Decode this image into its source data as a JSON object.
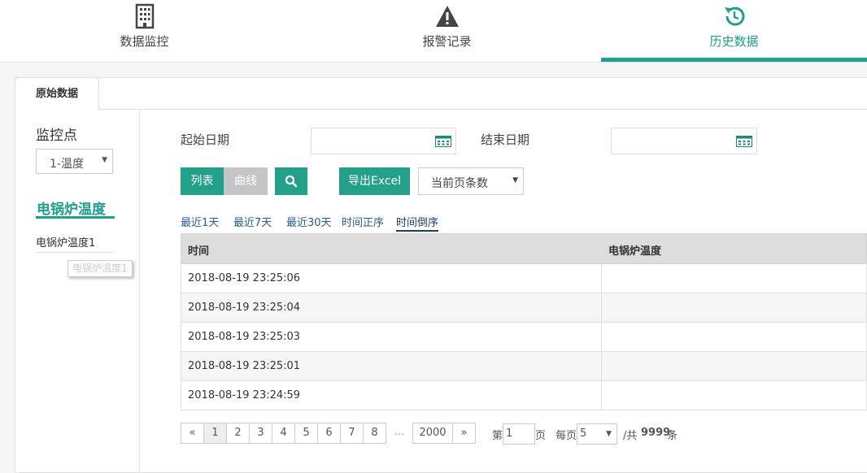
{
  "nav": {
    "tabs": [
      {
        "label": "数据监控",
        "icon": "building-icon"
      },
      {
        "label": "报警记录",
        "icon": "warning-icon"
      },
      {
        "label": "历史数据",
        "icon": "history-icon",
        "active": true
      }
    ]
  },
  "subtab": {
    "label": "原始数据"
  },
  "left": {
    "title": "监控点",
    "select_value": "1-温度",
    "group_label": "电锅炉温度",
    "item_label": "电锅炉温度1",
    "tooltip": "电锅炉温度1"
  },
  "filters": {
    "start_label": "起始日期",
    "end_label": "结束日期",
    "start_value": "",
    "end_value": ""
  },
  "toolbar": {
    "list_label": "列表",
    "curve_label": "曲线",
    "export_label": "导出Excel",
    "perpage_select": "当前页条数"
  },
  "quick": [
    "最近1天",
    "最近7天",
    "最近30天",
    "时间正序",
    "时间倒序"
  ],
  "table": {
    "headers": [
      "时间",
      "电锅炉温度"
    ],
    "rows": [
      [
        "2018-08-19 23:25:06",
        ""
      ],
      [
        "2018-08-19 23:25:04",
        ""
      ],
      [
        "2018-08-19 23:25:03",
        ""
      ],
      [
        "2018-08-19 23:25:01",
        ""
      ],
      [
        "2018-08-19 23:24:59",
        ""
      ]
    ]
  },
  "pagination": {
    "prev": "«",
    "pages": [
      "1",
      "2",
      "3",
      "4",
      "5",
      "6",
      "7",
      "8"
    ],
    "dots": "…",
    "last": "2000",
    "next": "»",
    "page_prefix": "第",
    "page_value": "1",
    "page_suffix": "页",
    "perpage_prefix": "每页",
    "perpage_value": "5",
    "total_prefix": "/共",
    "total": "9999",
    "total_suffix": "条"
  },
  "colors": {
    "accent": "#1fa08c",
    "link": "#2a5d8c"
  }
}
